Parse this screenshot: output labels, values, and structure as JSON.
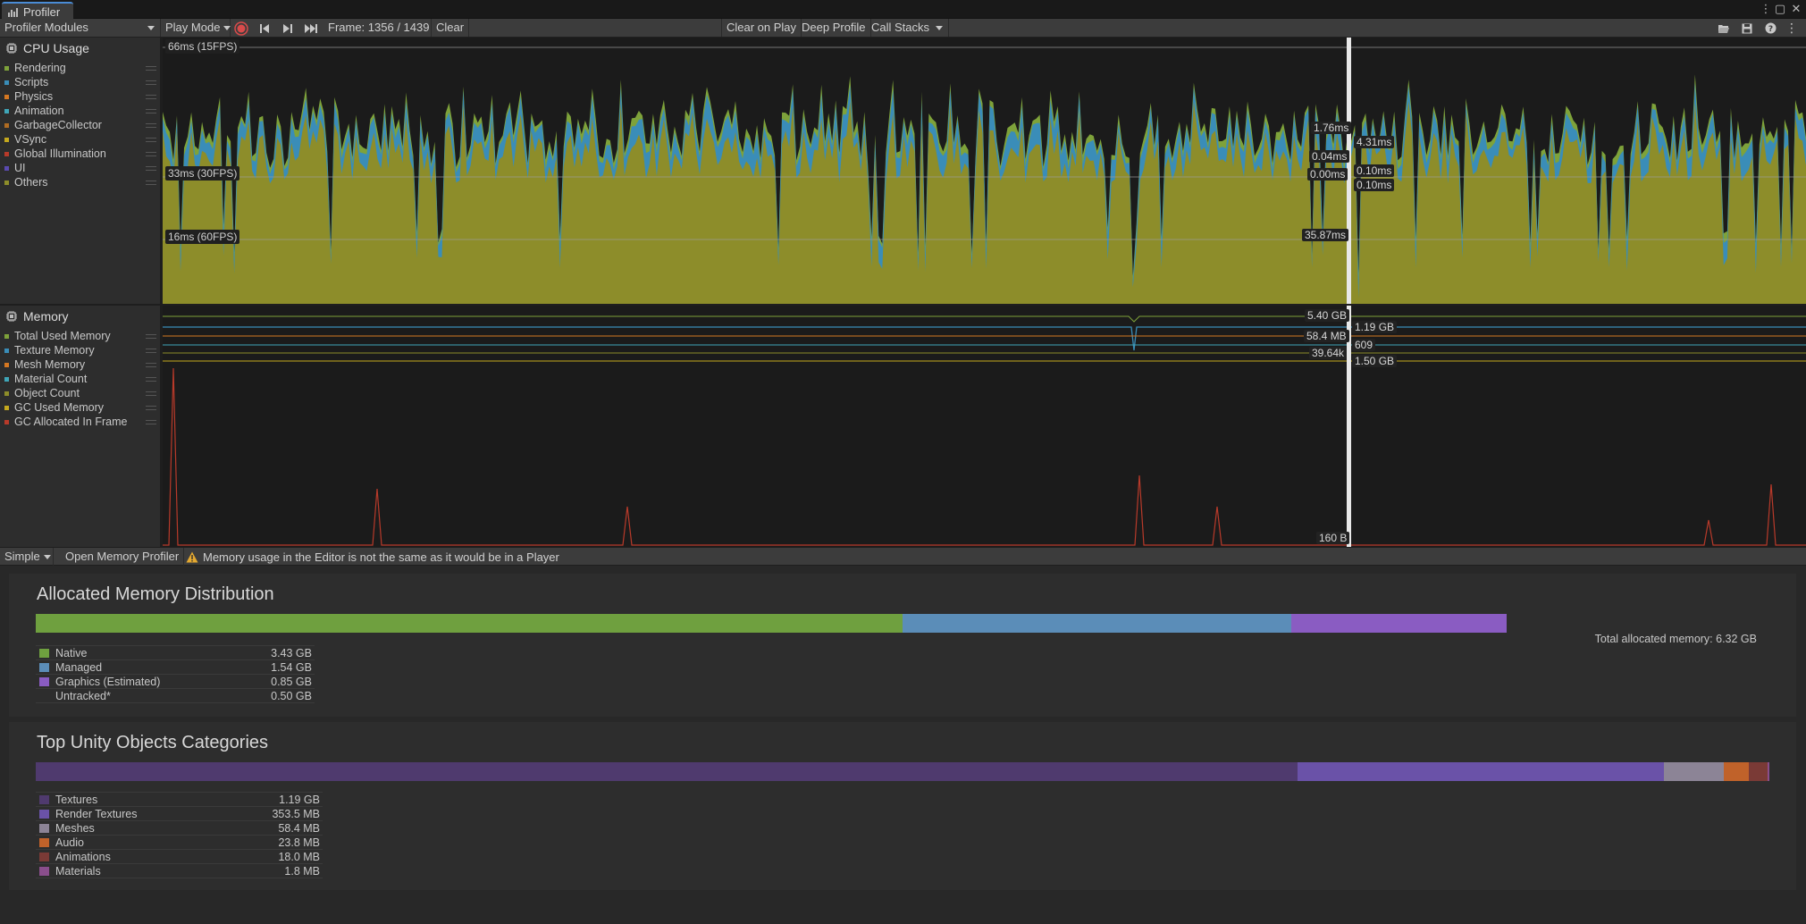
{
  "window": {
    "tab_title": "Profiler"
  },
  "toolbar": {
    "modules_label": "Profiler Modules",
    "play_mode_label": "Play Mode",
    "frame_label": "Frame: 1356 / 1439",
    "clear_label": "Clear",
    "clear_on_play_label": "Clear on Play",
    "deep_profile_label": "Deep Profile",
    "call_stacks_label": "Call Stacks"
  },
  "cpu": {
    "title": "CPU Usage",
    "legend": [
      {
        "label": "Rendering",
        "color": "#7ea23a"
      },
      {
        "label": "Scripts",
        "color": "#3a8db8"
      },
      {
        "label": "Physics",
        "color": "#d67822"
      },
      {
        "label": "Animation",
        "color": "#3fa6b8"
      },
      {
        "label": "GarbageCollector",
        "color": "#b06c22"
      },
      {
        "label": "VSync",
        "color": "#c4a81e"
      },
      {
        "label": "Global Illumination",
        "color": "#b83a2a"
      },
      {
        "label": "UI",
        "color": "#5a4ab0"
      },
      {
        "label": "Others",
        "color": "#8d8d2a"
      }
    ],
    "ref_66": "66ms (15FPS)",
    "ref_33": "33ms (30FPS)",
    "ref_16": "16ms (60FPS)",
    "sel_labels": {
      "rendering": "1.76ms",
      "scripts": "4.31ms",
      "physics": "0.04ms",
      "animation": "0.10ms",
      "gc": "0.00ms",
      "gi": "0.10ms",
      "others": "35.87ms"
    }
  },
  "memory": {
    "title": "Memory",
    "legend": [
      {
        "label": "Total Used Memory",
        "color": "#7ea23a"
      },
      {
        "label": "Texture Memory",
        "color": "#3a8db8"
      },
      {
        "label": "Mesh Memory",
        "color": "#d67822"
      },
      {
        "label": "Material Count",
        "color": "#3fa6b8"
      },
      {
        "label": "Object Count",
        "color": "#8d8d2a"
      },
      {
        "label": "GC Used Memory",
        "color": "#c4a81e"
      },
      {
        "label": "GC Allocated In Frame",
        "color": "#b83a2a"
      }
    ],
    "sel_labels": {
      "total": "5.40 GB",
      "texture": "1.19 GB",
      "mesh": "58.4 MB",
      "material": "609",
      "object": "39.64k",
      "gcused": "1.50 GB",
      "gcalloc": "160 B"
    }
  },
  "bottom_toolbar": {
    "view_label": "Simple",
    "open_memory_profiler_label": "Open Memory Profiler",
    "warning_text": "Memory usage in the Editor is not the same as it would be in a Player"
  },
  "allocated": {
    "title": "Allocated Memory Distribution",
    "total_text": "Total allocated memory: 6.32 GB",
    "segments": [
      {
        "name": "Native",
        "value": "3.43 GB",
        "fraction": 0.5427,
        "color": "#6fa03f"
      },
      {
        "name": "Managed",
        "value": "1.54 GB",
        "fraction": 0.2437,
        "color": "#5b8db8"
      },
      {
        "name": "Graphics (Estimated)",
        "value": "0.85 GB",
        "fraction": 0.1345,
        "color": "#8a5cc2"
      },
      {
        "name": "Untracked*",
        "value": "0.50 GB",
        "fraction": 0.0791,
        "color": ""
      }
    ]
  },
  "top_objects": {
    "title": "Top Unity Objects Categories",
    "segments": [
      {
        "name": "Textures",
        "value": "1.19 GB",
        "fraction": 0.7286,
        "color": "#4f3a6e"
      },
      {
        "name": "Render Textures",
        "value": "353.5 MB",
        "fraction": 0.2113,
        "color": "#6a52a8"
      },
      {
        "name": "Meshes",
        "value": "58.4 MB",
        "fraction": 0.0349,
        "color": "#8c8496"
      },
      {
        "name": "Audio",
        "value": "23.8 MB",
        "fraction": 0.0142,
        "color": "#c0622a"
      },
      {
        "name": "Animations",
        "value": "18.0 MB",
        "fraction": 0.0108,
        "color": "#7a3a36"
      },
      {
        "name": "Materials",
        "value": "1.8 MB",
        "fraction": 0.0011,
        "color": "#8a4e8c"
      }
    ]
  }
}
